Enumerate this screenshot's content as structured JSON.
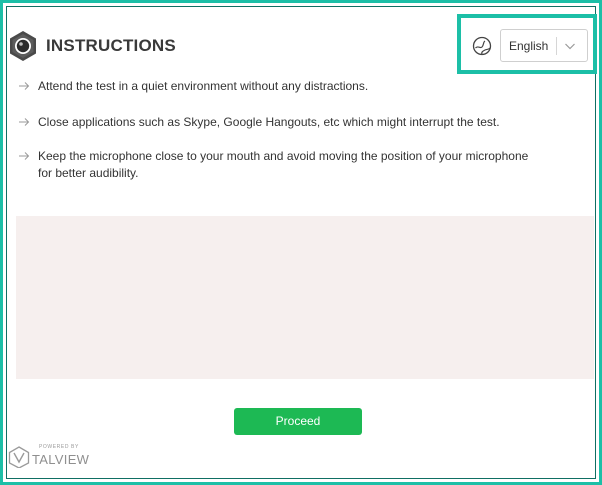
{
  "header": {
    "title": "INSTRUCTIONS",
    "logo_icon": "camera-lens-icon"
  },
  "language_selector": {
    "icon": "globe-icon",
    "selected_value": "English",
    "dropdown_icon": "chevron-down-icon"
  },
  "instructions": [
    {
      "text": "Attend the test in a quiet environment without any distractions."
    },
    {
      "text": "Close applications such as Skype, Google Hangouts, etc which might interrupt the test."
    },
    {
      "text": "Keep the microphone close to your mouth and avoid moving the position of your microphone for better audibility."
    }
  ],
  "proceed_button": {
    "label": "Proceed",
    "color": "#1db954"
  },
  "branding": {
    "powered_by": "POWERED BY",
    "name": "TALVIEW"
  },
  "colors": {
    "highlight": "#1cbfa7",
    "panel_background": "#f6efee"
  }
}
